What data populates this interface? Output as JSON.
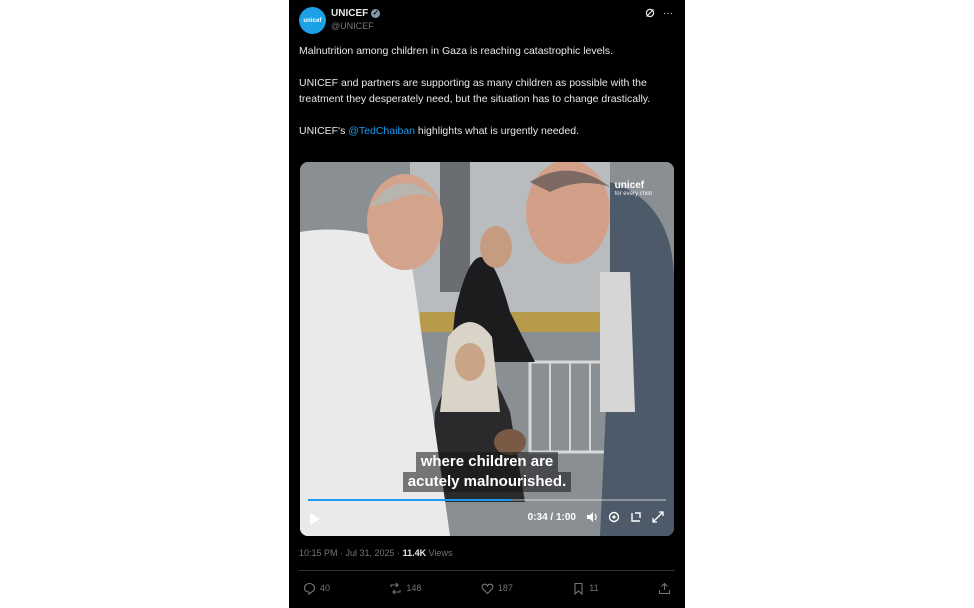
{
  "account": {
    "display_name": "UNICEF",
    "handle": "@UNICEF",
    "avatar_text": "unicef"
  },
  "tweet": {
    "paragraph1": "Malnutrition among children in Gaza is reaching catastrophic levels.",
    "paragraph2": "UNICEF and partners are supporting as many children as possible with the treatment they desperately need, but the situation has to change drastically.",
    "paragraph3_prefix": "UNICEF's ",
    "paragraph3_mention": "@TedChaiban",
    "paragraph3_suffix": " highlights what is urgently needed."
  },
  "video": {
    "watermark_logo": "unicef",
    "watermark_tagline": "for every child",
    "subtitle_line1": "where children are",
    "subtitle_line2": "acutely malnourished.",
    "time": "0:34 / 1:00",
    "progress": 0.567
  },
  "meta": {
    "timestamp": "10:15 PM · Jul 31, 2025 · ",
    "views_count": "11.4K",
    "views_label": " Views"
  },
  "actions": {
    "replies": "40",
    "reposts": "148",
    "likes": "187",
    "bookmarks": "11"
  },
  "colors": {
    "background": "#000000",
    "accent": "#1d9bf0",
    "muted": "#71767b"
  }
}
